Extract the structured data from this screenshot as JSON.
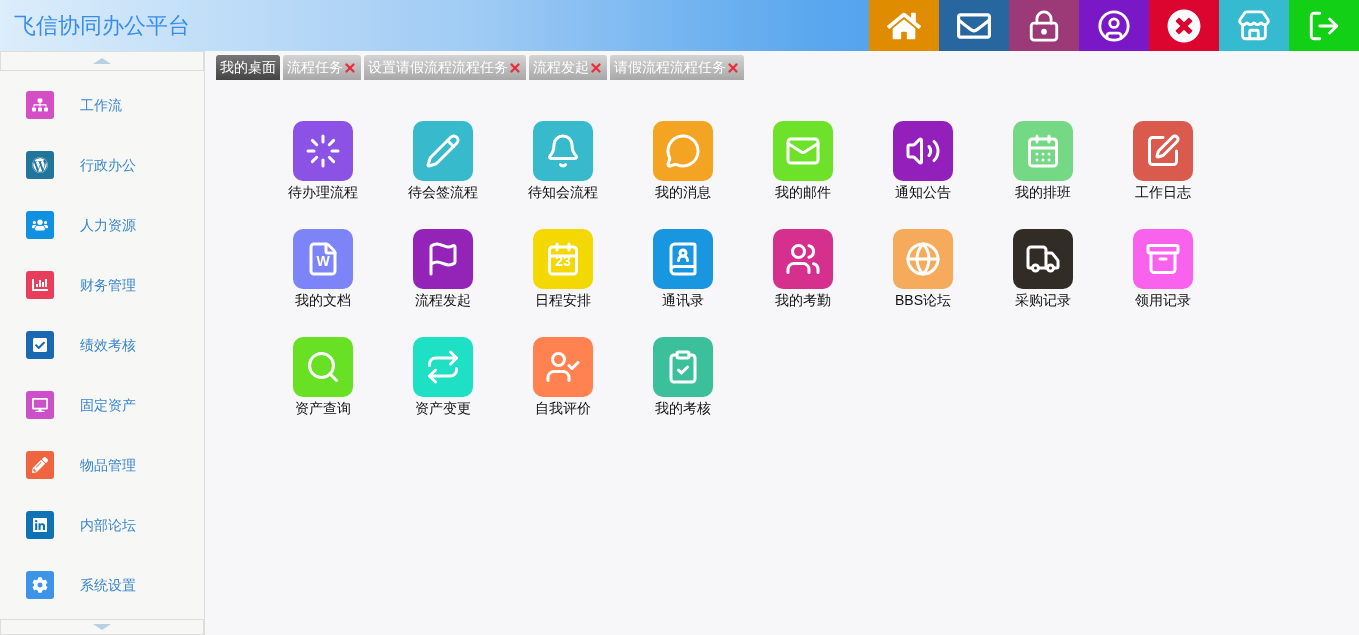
{
  "header": {
    "title": "飞信协同办公平台"
  },
  "toolbar": [
    {
      "color": "#e08c00"
    },
    {
      "color": "#2866a0"
    },
    {
      "color": "#9c3a78"
    },
    {
      "color": "#7a18c8"
    },
    {
      "color": "#dc0530"
    },
    {
      "color": "#35bad0"
    },
    {
      "color": "#12d016"
    }
  ],
  "sidebar": {
    "items": [
      {
        "label": "工作流",
        "color": "#d44fc6"
      },
      {
        "label": "行政办公",
        "color": "#21759b"
      },
      {
        "label": "人力资源",
        "color": "#0f90e0"
      },
      {
        "label": "财务管理",
        "color": "#e83e5c"
      },
      {
        "label": "绩效考核",
        "color": "#1a68b2"
      },
      {
        "label": "固定资产",
        "color": "#cc50c8"
      },
      {
        "label": "物品管理",
        "color": "#ee6540"
      },
      {
        "label": "内部论坛",
        "color": "#0f72b4"
      },
      {
        "label": "系统设置",
        "color": "#3c94e8"
      }
    ]
  },
  "tabs": [
    {
      "label": "我的桌面",
      "selected": true,
      "closable": false
    },
    {
      "label": "流程任务",
      "selected": false,
      "closable": true
    },
    {
      "label": "设置请假流程流程任务",
      "selected": false,
      "closable": true
    },
    {
      "label": "流程发起",
      "selected": false,
      "closable": true
    },
    {
      "label": "请假流程流程任务",
      "selected": false,
      "closable": true
    }
  ],
  "apps": [
    {
      "label": "待办理流程",
      "color": "#8c52e6"
    },
    {
      "label": "待会签流程",
      "color": "#36bacc"
    },
    {
      "label": "待知会流程",
      "color": "#36bacc"
    },
    {
      "label": "我的消息",
      "color": "#f4a423"
    },
    {
      "label": "我的邮件",
      "color": "#6ee22a"
    },
    {
      "label": "通知公告",
      "color": "#9420bc"
    },
    {
      "label": "我的排班",
      "color": "#74d884"
    },
    {
      "label": "工作日志",
      "color": "#da5a4e"
    },
    {
      "label": "我的文档",
      "color": "#7c84f8",
      "icon_text": "W"
    },
    {
      "label": "流程发起",
      "color": "#9424b8"
    },
    {
      "label": "日程安排",
      "color": "#f4d802",
      "icon_text": "23"
    },
    {
      "label": "通讯录",
      "color": "#1896e0"
    },
    {
      "label": "我的考勤",
      "color": "#d6308e"
    },
    {
      "label": "BBS论坛",
      "color": "#f6aa5c"
    },
    {
      "label": "采购记录",
      "color": "#322c26"
    },
    {
      "label": "领用记录",
      "color": "#f862ec"
    },
    {
      "label": "资产查询",
      "color": "#68e024"
    },
    {
      "label": "资产变更",
      "color": "#1ee0c4"
    },
    {
      "label": "自我评价",
      "color": "#ff8250"
    },
    {
      "label": "我的考核",
      "color": "#3cc09c"
    }
  ]
}
